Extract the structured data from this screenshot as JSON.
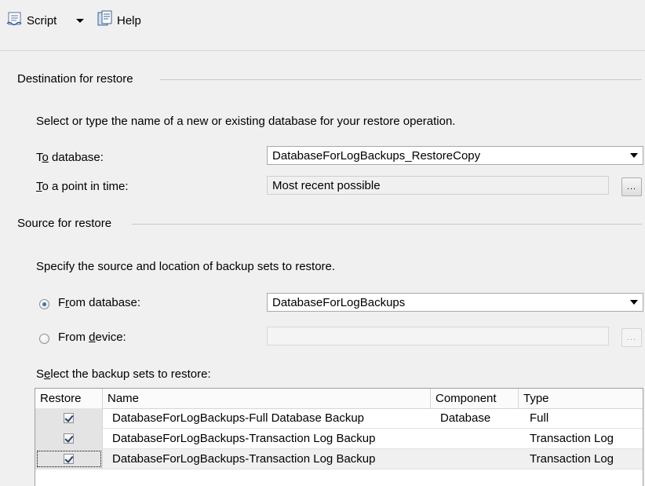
{
  "toolbar": {
    "script_label": "Script",
    "help_label": "Help"
  },
  "destination": {
    "title": "Destination for restore",
    "description": "Select or type the name of a new or existing database for your restore operation.",
    "to_database_label_prefix": "T",
    "to_database_label_mnemonic": "o",
    "to_database_label_suffix": " database:",
    "to_database_value": "DatabaseForLogBackups_RestoreCopy",
    "point_in_time_label_mnemonic": "T",
    "point_in_time_label_suffix": "o a point in time:",
    "point_in_time_value": "Most recent possible",
    "point_in_time_button": "..."
  },
  "source": {
    "title": "Source for restore",
    "description": "Specify the source and location of backup sets to restore.",
    "from_database_prefix": "F",
    "from_database_mnemonic": "r",
    "from_database_suffix": "om database:",
    "from_database_value": "DatabaseForLogBackups",
    "from_database_selected": true,
    "from_device_prefix": "From ",
    "from_device_mnemonic": "d",
    "from_device_suffix": "evice:",
    "from_device_value": "",
    "from_device_button": "...",
    "backup_sets_label_prefix": "S",
    "backup_sets_label_mnemonic": "e",
    "backup_sets_label_suffix": "lect the backup sets to restore:"
  },
  "backup_table": {
    "columns": [
      "Restore",
      "Name",
      "Component",
      "Type"
    ],
    "rows": [
      {
        "restore": true,
        "name": "DatabaseForLogBackups-Full Database Backup",
        "component": "Database",
        "type": "Full"
      },
      {
        "restore": true,
        "name": "DatabaseForLogBackups-Transaction Log  Backup",
        "component": "",
        "type": "Transaction Log"
      },
      {
        "restore": true,
        "name": "DatabaseForLogBackups-Transaction Log  Backup",
        "component": "",
        "type": "Transaction Log"
      }
    ]
  },
  "icons": {
    "script": "script-icon",
    "dropdown": "chevron-down-icon",
    "help": "help-icon"
  }
}
